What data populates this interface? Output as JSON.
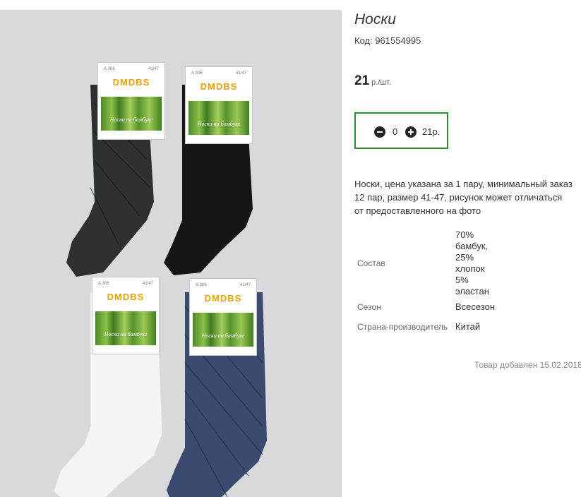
{
  "product": {
    "title": "Носки",
    "code": "Код: 961554995",
    "price_value": "21",
    "price_unit": "р./шт.",
    "quantity": "0",
    "total": "21р.",
    "description": "Носки, цена указана за 1 пару, минимальный заказ 12 пар, размер 41-47, рисунок может отличаться от предоставленного на фото",
    "properties": [
      {
        "label": "Состав",
        "value_lines": [
          "70%",
          "бамбук,",
          "25%",
          "хлопок",
          "5%",
          "эластан"
        ]
      },
      {
        "label": "Сезон",
        "value": "Всесезон"
      },
      {
        "label": "Страна-производитель",
        "value": "Китай"
      }
    ],
    "added": "Товар добавлен 15.02.2018"
  },
  "photo": {
    "tag_brand": "DMDBS",
    "tag_article": "A.306",
    "tag_size": "41/47",
    "tag_caption": "Носки на бамбуке",
    "sock_colors": [
      "#2d312f",
      "#151515",
      "#f4f4f4",
      "#3b4a6e"
    ]
  },
  "colors": {
    "accent_border": "#2e8b2e",
    "photo_background": "#d9d9db"
  },
  "icons": {
    "minus": "minus-circle-icon",
    "plus": "plus-circle-icon"
  }
}
